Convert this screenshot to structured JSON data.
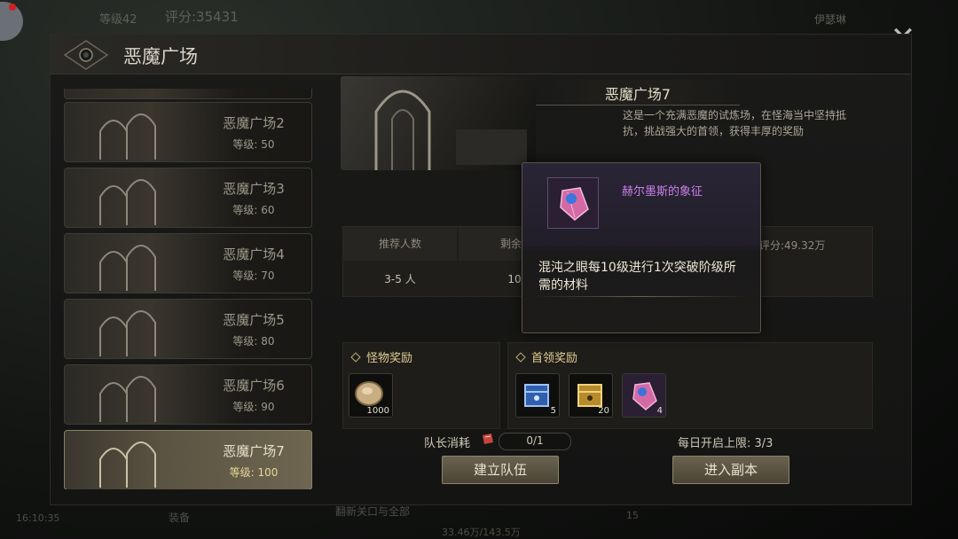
{
  "hud": {
    "level": "等级42",
    "score": "评分:35431",
    "player": "伊瑟琳"
  },
  "panel": {
    "title": "恶魔广场"
  },
  "stages": [
    {
      "name": "恶魔广场2",
      "level": "等级: 50"
    },
    {
      "name": "恶魔广场3",
      "level": "等级: 60"
    },
    {
      "name": "恶魔广场4",
      "level": "等级: 70"
    },
    {
      "name": "恶魔广场5",
      "level": "等级: 80"
    },
    {
      "name": "恶魔广场6",
      "level": "等级: 90"
    },
    {
      "name": "恶魔广场7",
      "level": "等级: 100",
      "selected": true
    }
  ],
  "detail": {
    "name": "恶魔广场7",
    "description": "这是一个充满恶魔的试炼场，在怪海当中坚持抵抗，挑战强大的首领，获得丰厚的奖励",
    "table": {
      "headers": [
        "推荐人数",
        "剩余奖"
      ],
      "values": [
        "3-5 人",
        "10/"
      ]
    },
    "score_hint": "评分:49.32万"
  },
  "rewards": {
    "monster": {
      "title": "怪物奖励",
      "items": [
        {
          "icon": "stone-icon",
          "count": "1000"
        }
      ]
    },
    "boss": {
      "title": "首领奖励",
      "items": [
        {
          "icon": "blue-chest-icon",
          "count": "5"
        },
        {
          "icon": "gold-chest-icon",
          "count": "20"
        },
        {
          "icon": "crystal-icon",
          "count": "4"
        }
      ]
    }
  },
  "cost": {
    "label": "队长消耗",
    "value": "0/1"
  },
  "daily_limit": "每日开启上限: 3/3",
  "buttons": {
    "create_team": "建立队伍",
    "enter_dungeon": "进入副本"
  },
  "tooltip": {
    "item_name": "赫尔墨斯的象征",
    "description": "混沌之眼每10级进行1次突破阶级所需的材料",
    "name_color": "#c780e8"
  },
  "bottom": {
    "t1": "16:10:35",
    "t2": "装备",
    "t3": "翻新关口与全部",
    "t4": "15",
    "t5": "33.46万/143.5万"
  },
  "colors": {
    "accent_gold": "#e2cf92",
    "selected_level": "#e6d79a",
    "tooltip_purple": "#c780e8"
  }
}
